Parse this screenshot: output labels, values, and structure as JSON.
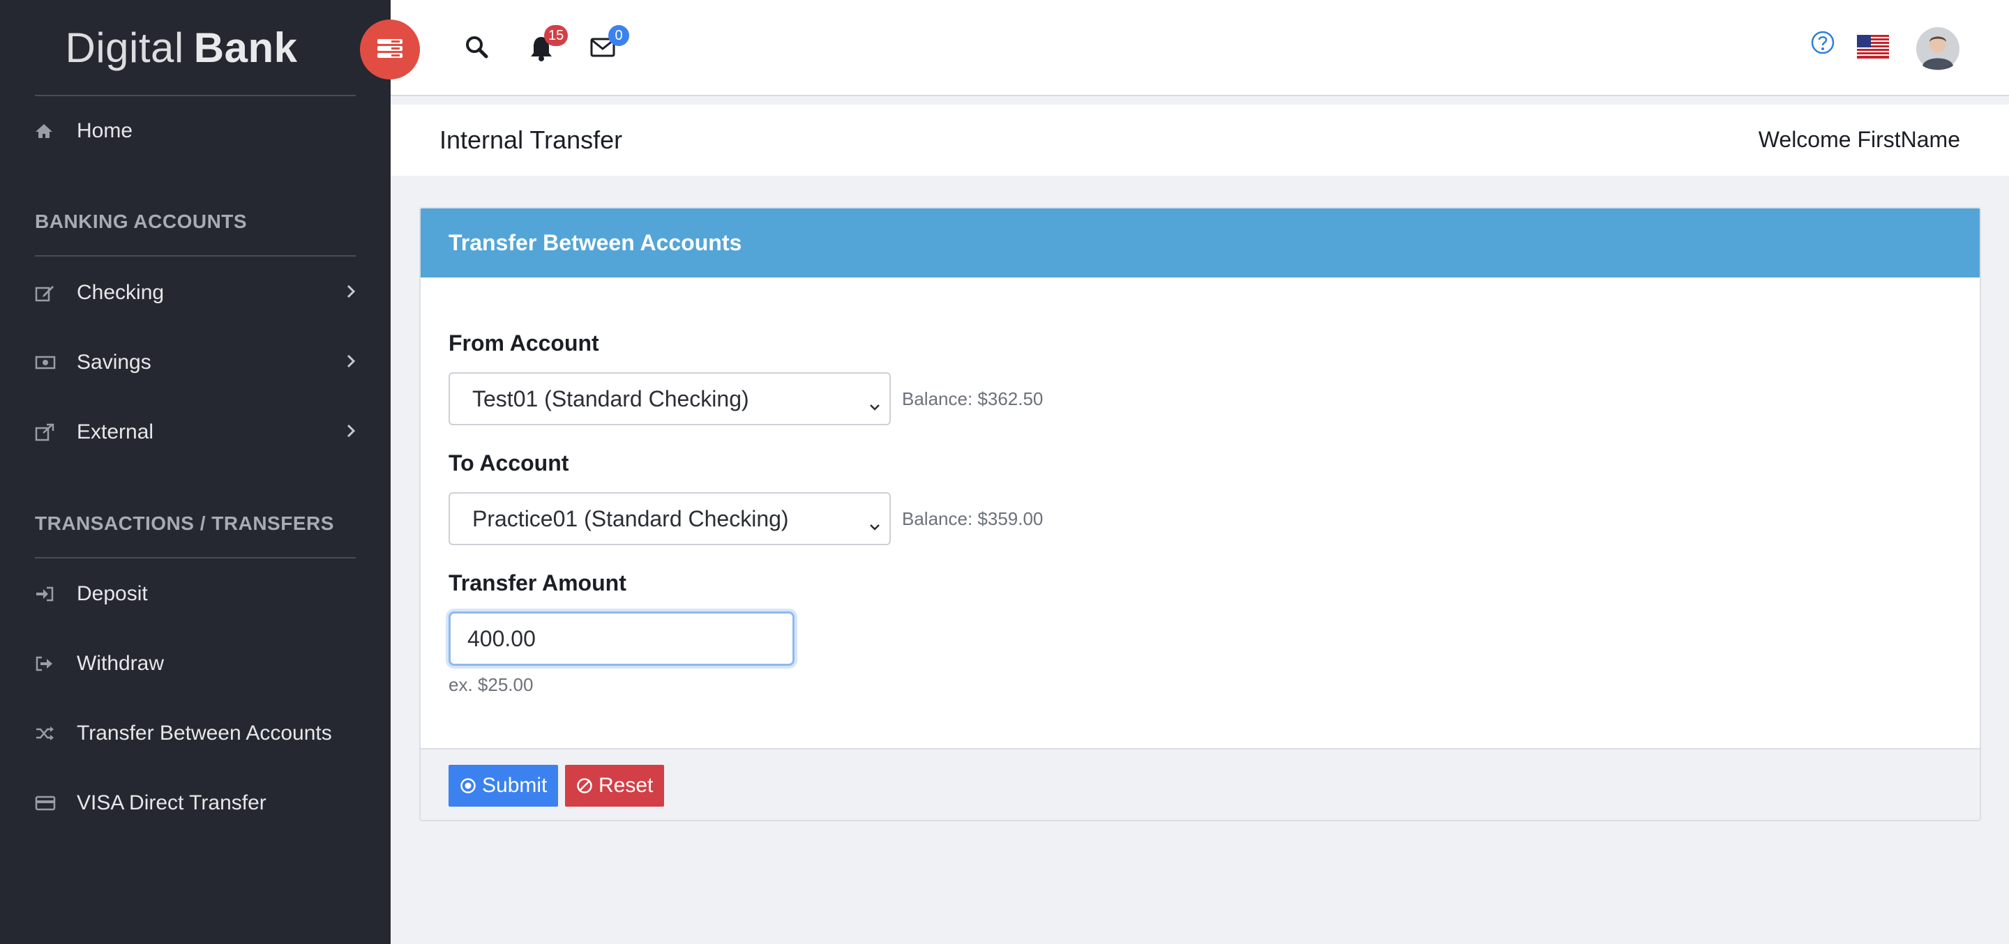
{
  "brand": {
    "light": "Digital",
    "bold": "Bank"
  },
  "sidebar": {
    "home": "Home",
    "section_accounts": "BANKING ACCOUNTS",
    "accounts": [
      {
        "label": "Checking"
      },
      {
        "label": "Savings"
      },
      {
        "label": "External"
      }
    ],
    "section_transactions": "TRANSACTIONS / TRANSFERS",
    "transactions": [
      {
        "label": "Deposit"
      },
      {
        "label": "Withdraw"
      },
      {
        "label": "Transfer Between Accounts"
      },
      {
        "label": "VISA Direct Transfer"
      }
    ]
  },
  "topbar": {
    "notifications_count": "15",
    "messages_count": "0"
  },
  "page": {
    "title": "Internal Transfer",
    "welcome": "Welcome FirstName"
  },
  "form": {
    "header": "Transfer Between Accounts",
    "from_label": "From Account",
    "from_value": "Test01 (Standard Checking)",
    "from_balance": "Balance: $362.50",
    "to_label": "To Account",
    "to_value": "Practice01 (Standard Checking)",
    "to_balance": "Balance: $359.00",
    "amount_label": "Transfer Amount",
    "amount_value": "400.00",
    "amount_hint": "ex. $25.00",
    "submit_label": "Submit",
    "reset_label": "Reset"
  },
  "colors": {
    "sidebar_bg": "#252830",
    "accent_red": "#e14d43",
    "card_header": "#52a5d6",
    "submit": "#3b82f0",
    "reset": "#d33f46"
  },
  "icons": {
    "home": "home-icon",
    "checking": "edit-icon",
    "savings": "money-icon",
    "external": "external-link-icon",
    "deposit": "sign-in-icon",
    "withdraw": "sign-out-icon",
    "transfer": "shuffle-icon",
    "visa": "credit-card-icon",
    "search": "search-icon",
    "bell": "bell-icon",
    "envelope": "envelope-icon",
    "help": "help-icon",
    "flag": "us-flag-icon"
  }
}
